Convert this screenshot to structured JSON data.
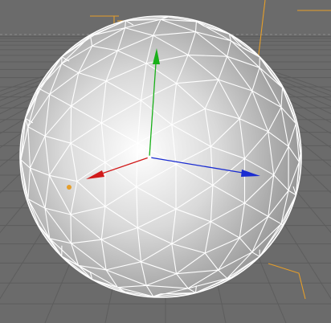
{
  "viewport": {
    "background_color": "#6b6b6b",
    "grid_color": "#5d5d5d",
    "horizon_color": "#8e8e8e",
    "selection_guide_color": "#e59e2a"
  },
  "object": {
    "type": "geodesic sphere",
    "surface_color": "#c9c9c9",
    "wireframe_color": "#ffffff"
  },
  "axes": {
    "x_axis_color": "#d11a1a",
    "y_axis_color": "#19b019",
    "z_axis_color": "#1a2cd1",
    "axis_center_color": "#ffffff",
    "x_handle_icon": "cone-arrow-icon",
    "y_handle_icon": "cone-arrow-icon",
    "z_handle_icon": "cone-arrow-icon"
  }
}
